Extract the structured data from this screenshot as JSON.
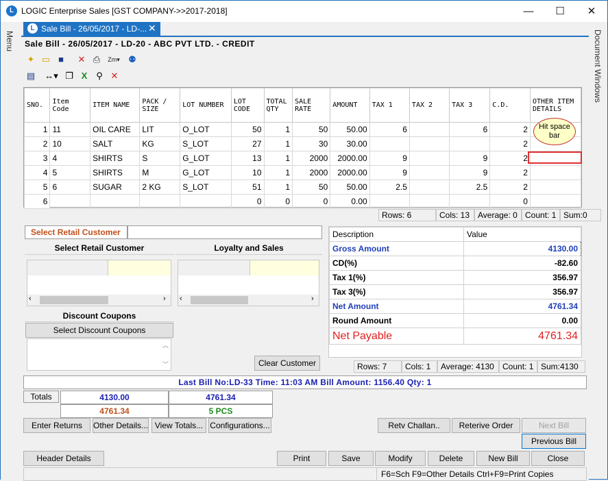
{
  "app_title": "LOGIC Enterprise Sales  [GST COMPANY->>2017-2018]",
  "window_controls": {
    "minimize": "—",
    "maximize": "☐",
    "close": "✕"
  },
  "side_menu_label": "Menu",
  "side_docwin_label": "Document Windows",
  "tab": {
    "label": "Sale Bill - 26/05/2017 - LD-...",
    "close": "✕"
  },
  "form_header": "Sale Bill - 26/05/2017 - LD-20 - ABC PVT LTD. - CREDIT",
  "grid": {
    "columns": [
      "SNO.",
      "Item Code",
      "ITEM NAME",
      "PACK / SIZE",
      "LOT NUMBER",
      "LOT CODE",
      "TOTAL QTY",
      "SALE RATE",
      "AMOUNT",
      "TAX 1",
      "TAX 2",
      "TAX 3",
      "C.D.",
      "OTHER ITEM DETAILS"
    ],
    "rows": [
      [
        "1",
        "11",
        "OIL CARE",
        "LIT",
        "O_LOT",
        "50",
        "1",
        "50",
        "50.00",
        "6",
        "",
        "6",
        "2",
        ""
      ],
      [
        "2",
        "10",
        "SALT",
        "KG",
        "S_LOT",
        "27",
        "1",
        "30",
        "30.00",
        "",
        "",
        "",
        "2",
        ""
      ],
      [
        "3",
        "4",
        "SHIRTS",
        "S",
        "G_LOT",
        "13",
        "1",
        "2000",
        "2000.00",
        "9",
        "",
        "9",
        "2",
        ""
      ],
      [
        "4",
        "5",
        "SHIRTS",
        "M",
        "G_LOT",
        "10",
        "1",
        "2000",
        "2000.00",
        "9",
        "",
        "9",
        "2",
        ""
      ],
      [
        "5",
        "6",
        "SUGAR",
        "2 KG",
        "S_LOT",
        "51",
        "1",
        "50",
        "50.00",
        "2.5",
        "",
        "2.5",
        "2",
        ""
      ],
      [
        "6",
        "",
        "",
        "",
        "",
        "0",
        "0",
        "0",
        "0.00",
        "",
        "",
        "",
        "0",
        ""
      ]
    ],
    "tooltip": "Hit space bar",
    "status": {
      "rows": "Rows: 6",
      "cols": "Cols: 13",
      "average": "Average: 0",
      "count": "Count: 1",
      "sum": "Sum:0"
    }
  },
  "retail": {
    "label": "Select Retail Customer",
    "select_header": "Select Retail Customer",
    "loyalty_header": "Loyalty and Sales",
    "discount_header": "Discount Coupons",
    "discount_button": "Select Discount Coupons",
    "clear_button": "Clear Customer"
  },
  "summary": {
    "headers": [
      "Description",
      "Value"
    ],
    "rows": [
      {
        "label": "Gross Amount",
        "value": "4130.00"
      },
      {
        "label": "CD(%)",
        "value": "-82.60"
      },
      {
        "label": "Tax 1(%)",
        "value": "356.97"
      },
      {
        "label": "Tax 3(%)",
        "value": "356.97"
      },
      {
        "label": "Net Amount",
        "value": "4761.34"
      },
      {
        "label": "Round Amount",
        "value": "0.00"
      }
    ],
    "net_payable_label": "Net Payable",
    "net_payable_value": "4761.34",
    "status": {
      "rows": "Rows: 7",
      "cols": "Cols: 1",
      "average": "Average: 4130",
      "count": "Count: 1",
      "sum": "Sum:4130"
    }
  },
  "last_bill": "Last Bill No:LD-33  Time: 11:03 AM   Bill Amount:  1156.40   Qty:  1",
  "totals": {
    "label": "Totals",
    "gross": "4130.00",
    "net": "4761.34",
    "net2": "4761.34",
    "qty": "5 PCS"
  },
  "buttons": {
    "enter_returns": "Enter Returns",
    "other_details": "Other Details...",
    "view_totals": "View Totals...",
    "configurations": "Configurations...",
    "retv_challan": "Retv Challan..",
    "retrieve_order": "Reterive Order",
    "next_bill": "Next Bill",
    "previous_bill": "Previous Bill",
    "header_details": "Header Details",
    "print": "Print",
    "save": "Save",
    "modify": "Modify",
    "delete": "Delete",
    "new_bill": "New Bill",
    "close": "Close"
  },
  "shortcut_hint": "F6=Sch  F9=Other Details  Ctrl+F9=Print Copies",
  "colors": {
    "accent": "#1f73c4",
    "retail_label": "#c0501a",
    "blue_text": "#1f3fb8",
    "net_payable": "#e02020",
    "total_orange": "#c0501a",
    "total_green": "#1a8a1a"
  }
}
